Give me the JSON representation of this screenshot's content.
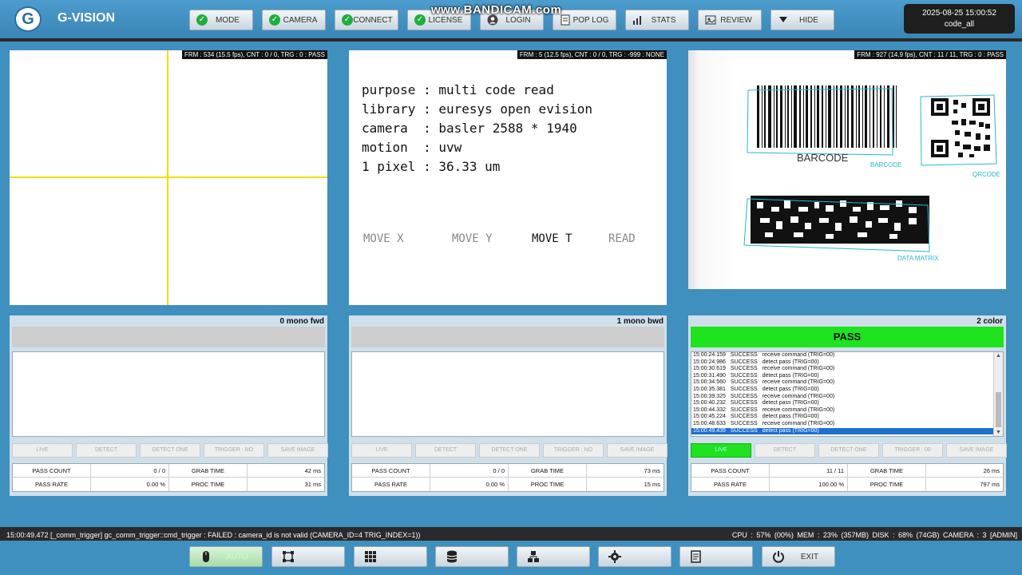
{
  "app": {
    "title": "G-VISION",
    "logo_letter": "G"
  },
  "watermark": "www.BANDICAM.com",
  "nav": {
    "items": [
      {
        "label": "MODE",
        "icon": "check-icon"
      },
      {
        "label": "CAMERA",
        "icon": "check-icon"
      },
      {
        "label": "CONNECT",
        "icon": "check-icon"
      },
      {
        "label": "LICENSE",
        "icon": "check-icon"
      },
      {
        "label": "LOGIN",
        "icon": "user-icon"
      },
      {
        "label": "POP LOG",
        "icon": "document-icon"
      },
      {
        "label": "STATS",
        "icon": "bar-chart-icon"
      },
      {
        "label": "REVIEW",
        "icon": "image-review-icon"
      },
      {
        "label": "HIDE",
        "icon": "triangle-down-icon"
      }
    ]
  },
  "clock": {
    "datetime": "2025-08-25 15:00:52",
    "recipe": "code_all"
  },
  "cameras": [
    {
      "overlay": "FRM : 534 (15.5 fps), CNT : 0 / 0, TRG : 0 : PASS",
      "title": "0 mono fwd",
      "result": ""
    },
    {
      "overlay": "FRM : 5 (12.5 fps), CNT : 0 / 0, TRG : -999 : NONE",
      "title": "1 mono bwd",
      "result": ""
    },
    {
      "overlay": "FRM : 927 (14.9 fps), CNT : 11 / 11, TRG : 0 : PASS",
      "title": "2 color",
      "result": "PASS"
    }
  ],
  "info": {
    "lines": [
      "purpose : multi code read",
      "library : euresys open evision",
      "camera  : basler 2588 * 1940",
      "motion  : uvw",
      "1 pixel : 36.33 um"
    ],
    "moves": [
      "MOVE X",
      "MOVE Y",
      "MOVE T",
      "READ"
    ]
  },
  "codes": {
    "barcode_caption": "BARCODE",
    "labels": [
      "BARCODE",
      "QRCODE",
      "DATA MATRIX"
    ]
  },
  "log": [
    {
      "time": "15:00:24.159",
      "status": "SUCCESS",
      "msg": "receive command (TRIG=00)"
    },
    {
      "time": "15:00:24.986",
      "status": "SUCCESS",
      "msg": "detect pass (TRIG=00)"
    },
    {
      "time": "15:00:30.619",
      "status": "SUCCESS",
      "msg": "receive command (TRIG=00)"
    },
    {
      "time": "15:00:31.490",
      "status": "SUCCESS",
      "msg": "detect pass (TRIG=00)"
    },
    {
      "time": "15:00:34.560",
      "status": "SUCCESS",
      "msg": "receive command (TRIG=00)"
    },
    {
      "time": "15:00:35.381",
      "status": "SUCCESS",
      "msg": "detect pass (TRIG=00)"
    },
    {
      "time": "15:00:39.325",
      "status": "SUCCESS",
      "msg": "receive command (TRIG=00)"
    },
    {
      "time": "15:00:40.232",
      "status": "SUCCESS",
      "msg": "detect pass (TRIG=00)"
    },
    {
      "time": "15:00:44.332",
      "status": "SUCCESS",
      "msg": "receive command (TRIG=00)"
    },
    {
      "time": "15:00:45.224",
      "status": "SUCCESS",
      "msg": "detect pass (TRIG=00)"
    },
    {
      "time": "15:00:48.633",
      "status": "SUCCESS",
      "msg": "receive command (TRIG=00)"
    },
    {
      "time": "15:00:49.439",
      "status": "SUCCESS",
      "msg": "detect pass (TRIG=00)"
    }
  ],
  "buttons": {
    "p0": [
      "LIVE",
      "DETECT",
      "DETECT ONE",
      "TRIGGER : NO",
      "SAVE IMAGE"
    ],
    "p1": [
      "LIVE",
      "DETECT",
      "DETECT ONE",
      "TRIGGER : NO",
      "SAVE IMAGE"
    ],
    "p2": [
      "LIVE",
      "DETECT",
      "DETECT ONE",
      "TRIGGER : 00",
      "SAVE IMAGE"
    ]
  },
  "stats_labels": {
    "pass_count": "PASS COUNT",
    "pass_rate": "PASS RATE",
    "grab_time": "GRAB TIME",
    "proc_time": "PROC TIME"
  },
  "stats": [
    {
      "pass_count": "0 / 0",
      "pass_rate": "0.00 %",
      "grab_time": "42 ms",
      "proc_time": "31 ms"
    },
    {
      "pass_count": "0 / 0",
      "pass_rate": "0.00 %",
      "grab_time": "73 ms",
      "proc_time": "15 ms"
    },
    {
      "pass_count": "11 / 11",
      "pass_rate": "100.00 %",
      "grab_time": "26 ms",
      "proc_time": "797 ms"
    }
  ],
  "statusbar": {
    "message": "15:00:49.472  [_comm_trigger] gc_comm_trigger::cmd_trigger : FAILED : camera_id is not valid (CAMERA_ID=4 TRIG_INDEX=1))",
    "system": "CPU : 57% (00%)     MEM : 23% (357MB)     DISK : 68% (74GB)     CAMERA : 3     [ADMIN]"
  },
  "footer": {
    "items": [
      {
        "label": "AUTO",
        "icon": "mouse-icon"
      },
      {
        "label": "",
        "icon": "crop-icon"
      },
      {
        "label": "",
        "icon": "grid-icon"
      },
      {
        "label": "",
        "icon": "database-icon"
      },
      {
        "label": "",
        "icon": "hierarchy-icon"
      },
      {
        "label": "",
        "icon": "gear-icon"
      },
      {
        "label": "",
        "icon": "checklist-icon"
      },
      {
        "label": "EXIT",
        "icon": "power-icon"
      }
    ]
  }
}
